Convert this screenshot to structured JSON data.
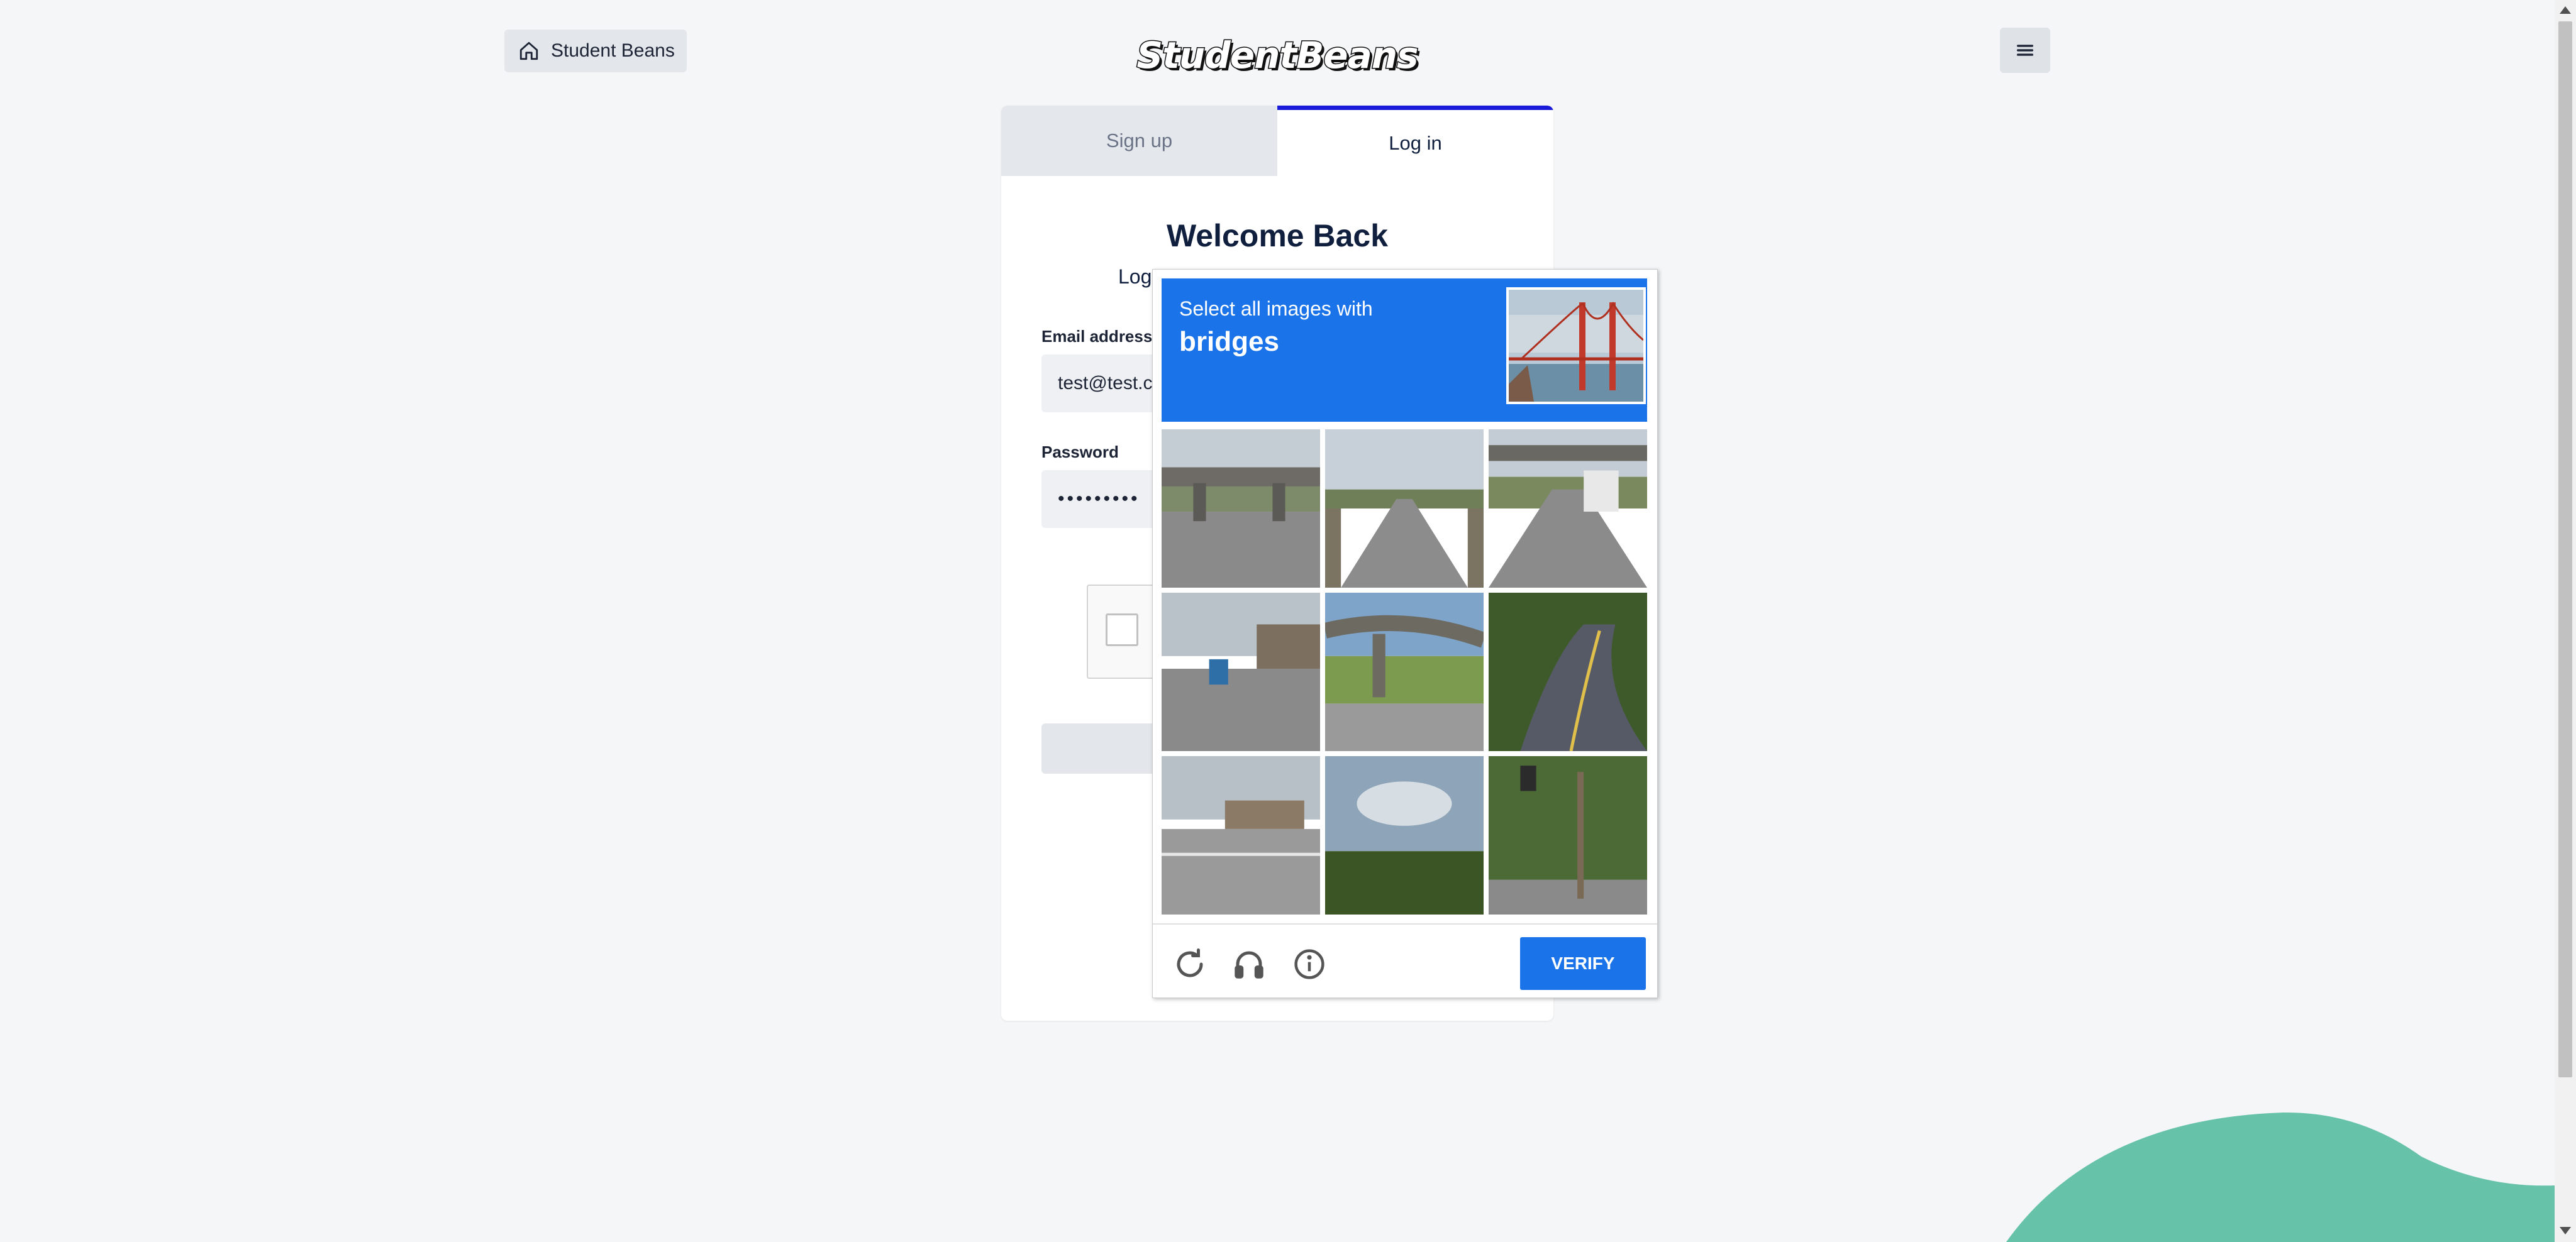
{
  "header": {
    "home_label": "Student Beans",
    "logo_text": "StudentBeans"
  },
  "tabs": [
    {
      "label": "Sign up"
    },
    {
      "label": "Log in"
    }
  ],
  "login": {
    "title": "Welcome Back",
    "subtitle_visible": "Log",
    "email_label": "Email address",
    "email_value": "test@test.c",
    "password_label": "Password",
    "password_value": "•••••••••"
  },
  "captcha": {
    "prompt_line1": "Select all images with",
    "prompt_keyword": "bridges",
    "verify_label": "VERIFY",
    "footer_icons": [
      "reload-icon",
      "audio-icon",
      "info-icon"
    ],
    "tiles": [
      "highway overpass",
      "straight road",
      "overpass with truck",
      "street intersection with bus",
      "highway overpass",
      "curved road with car",
      "road intersection",
      "cloudy sky with trees",
      "traffic light on road"
    ]
  },
  "colors": {
    "brand_accent": "#1a1ad9",
    "captcha_blue": "#1a73e8",
    "blob_green": "#66c2a8",
    "background": "#f5f6f8"
  }
}
